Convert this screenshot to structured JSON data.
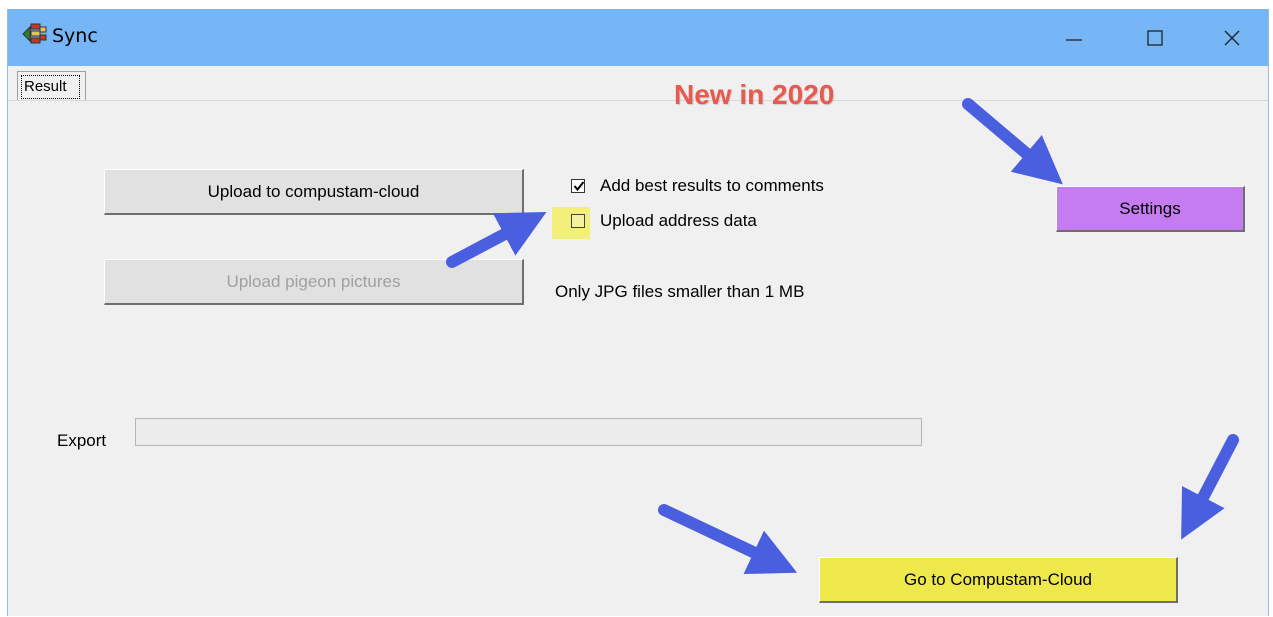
{
  "window": {
    "title": "Sync",
    "controls": [
      "minimize",
      "maximize",
      "close"
    ]
  },
  "tabs": [
    {
      "label": "Result",
      "selected": true
    }
  ],
  "buttons": {
    "upload_cloud": "Upload to compustam-cloud",
    "upload_pictures": "Upload pigeon pictures",
    "upload_pictures_enabled": false,
    "settings": "Settings",
    "go_to_cloud": "Go to Compustam-Cloud"
  },
  "options": [
    {
      "label": "Add best results to comments",
      "checked": true
    },
    {
      "label": "Upload address data",
      "checked": false
    }
  ],
  "notes": {
    "jpg_hint": "Only JPG files smaller than 1 MB"
  },
  "export": {
    "label": "Export",
    "progress": 0
  },
  "annotations": {
    "headline": "New in 2020",
    "arrow_color": "#4a5ee0",
    "headline_color": "#e85a4f"
  },
  "colors": {
    "titlebar": "#76b5f6",
    "settings_button": "#c57cf0",
    "cloud_button": "#efe84a",
    "checkbox_highlight": "#f2f07a"
  }
}
